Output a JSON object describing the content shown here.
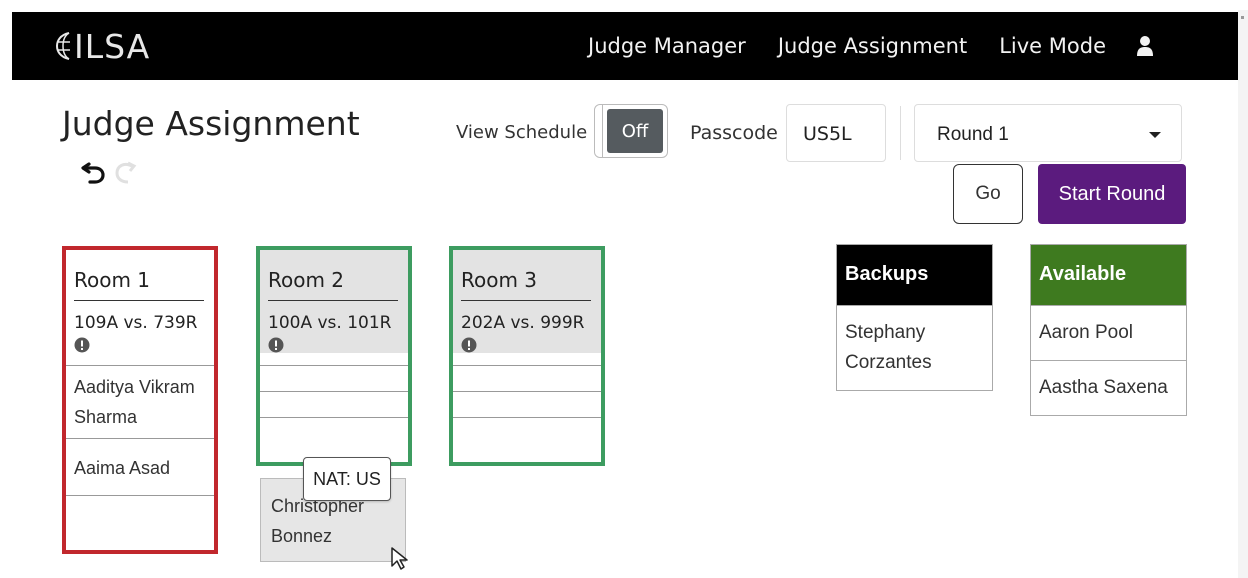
{
  "app": {
    "logo_text": "ILSA"
  },
  "nav": {
    "items": [
      {
        "label": "Judge Manager"
      },
      {
        "label": "Judge Assignment"
      },
      {
        "label": "Live Mode"
      }
    ],
    "user_icon": "user-icon"
  },
  "page": {
    "title": "Judge Assignment"
  },
  "controls": {
    "view_schedule_label": "View Schedule",
    "toggle_state": "Off",
    "passcode_label": "Passcode",
    "passcode_value": "US5L",
    "round_selected": "Round 1",
    "go_label": "Go",
    "start_label": "Start Round"
  },
  "rooms": [
    {
      "name": "Room 1",
      "match": "109A vs. 739R",
      "status": "red",
      "judges": [
        "Aaditya Vikram Sharma",
        "Aaima Asad"
      ]
    },
    {
      "name": "Room 2",
      "match": "100A vs. 101R",
      "status": "green",
      "judges": []
    },
    {
      "name": "Room 3",
      "match": "202A vs. 999R",
      "status": "green",
      "judges": []
    }
  ],
  "backups": {
    "title": "Backups",
    "items": [
      "Stephany Corzantes"
    ],
    "color": "#000000"
  },
  "available": {
    "title": "Available",
    "items": [
      "Aaron Pool",
      "Aastha Saxena"
    ],
    "color": "#3e7a1f"
  },
  "dragging": {
    "name": "Christopher Bonnez",
    "tooltip": "NAT: US"
  },
  "colors": {
    "navbar": "#000000",
    "start_button": "#5b1b7e",
    "room_red": "#c1272d",
    "room_green": "#3d9c60"
  }
}
